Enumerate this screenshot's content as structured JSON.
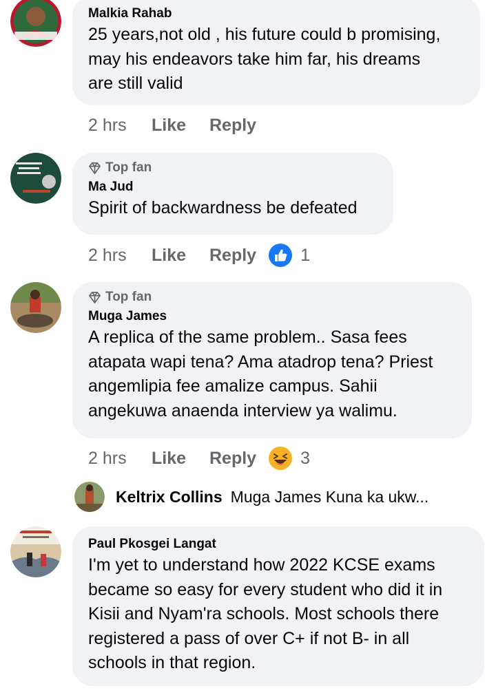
{
  "comments": [
    {
      "author": "Malkia Rahab",
      "badge": "",
      "lines": [
        "25 years,not old , his future could b promising,",
        "may his endeavors take him far, his dreams",
        "are still valid"
      ],
      "time": "2 hrs",
      "like": "Like",
      "reply": "Reply",
      "reaction": "",
      "reaction_count": ""
    },
    {
      "author": "Ma Jud",
      "badge": "Top fan",
      "lines": [
        "Spirit of backwardness be defeated"
      ],
      "time": "2 hrs",
      "like": "Like",
      "reply": "Reply",
      "reaction": "like-icon",
      "reaction_count": "1"
    },
    {
      "author": "Muga James",
      "badge": "Top fan",
      "lines": [
        "A replica of the same problem.. Sasa fees",
        "atapata wapi tena? Ama atadrop tena? Priest",
        "angemlipia fee amalize campus. Sahii",
        "angekuwa anaenda interview ya walimu."
      ],
      "time": "2 hrs",
      "like": "Like",
      "reply": "Reply",
      "reaction": "haha-icon",
      "reaction_count": "3"
    },
    {
      "author": "Paul Pkosgei Langat",
      "badge": "",
      "lines": [
        "I'm yet to understand how 2022 KCSE exams",
        "became so easy for every student who did it in",
        "Kisii and Nyam'ra schools. Most schools there",
        "registered a pass of over C+ if not B- in all",
        "schools in that region."
      ]
    }
  ],
  "reply_preview": {
    "author": "Keltrix Collins",
    "text": "Muga James  Kuna ka ukw..."
  },
  "colors": {
    "bubble": "#f0f2f5",
    "muted": "#65676b",
    "like_blue": "#1877f2",
    "haha_yellow": "#f7b125"
  }
}
